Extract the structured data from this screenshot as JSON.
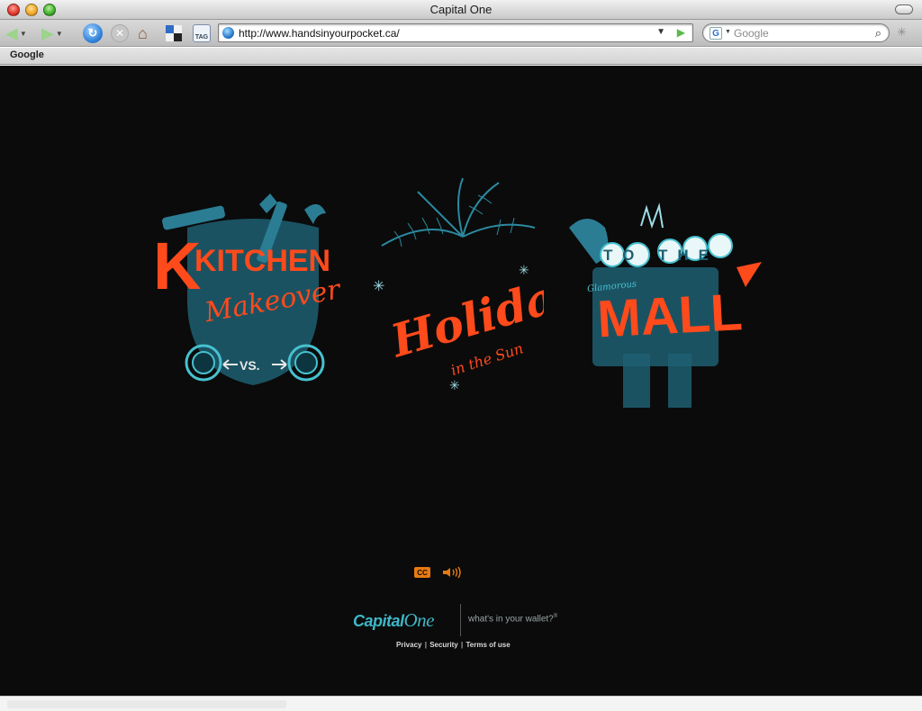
{
  "window": {
    "title": "Capital One"
  },
  "toolbar": {
    "url": "http://www.handsinyourpocket.ca/",
    "tag_label": "TAG",
    "search_placeholder": "Google"
  },
  "bookmarks_bar": {
    "items": [
      {
        "label": "Google"
      }
    ]
  },
  "page": {
    "background": "#0b0b0b",
    "accent_orange": "#ff4a1c",
    "accent_teal": "#3fb7c7",
    "tiles": [
      {
        "title_line1": "KITCHEN",
        "title_line2": "Makeover",
        "subtitle": "VS."
      },
      {
        "title_line1": "Holiday",
        "title_line2": "in the Sun"
      },
      {
        "title_line1": "TO THE",
        "title_small": "Glamorous",
        "title_line2": "MALL"
      }
    ],
    "controls": {
      "cc_label": "CC"
    },
    "brand": {
      "logo_main": "Capital",
      "logo_one": "One",
      "tagline": "what's in your wallet?",
      "tagline_mark": "®"
    },
    "footer": {
      "privacy": "Privacy",
      "security": "Security",
      "terms": "Terms of use",
      "separator": "|"
    }
  }
}
